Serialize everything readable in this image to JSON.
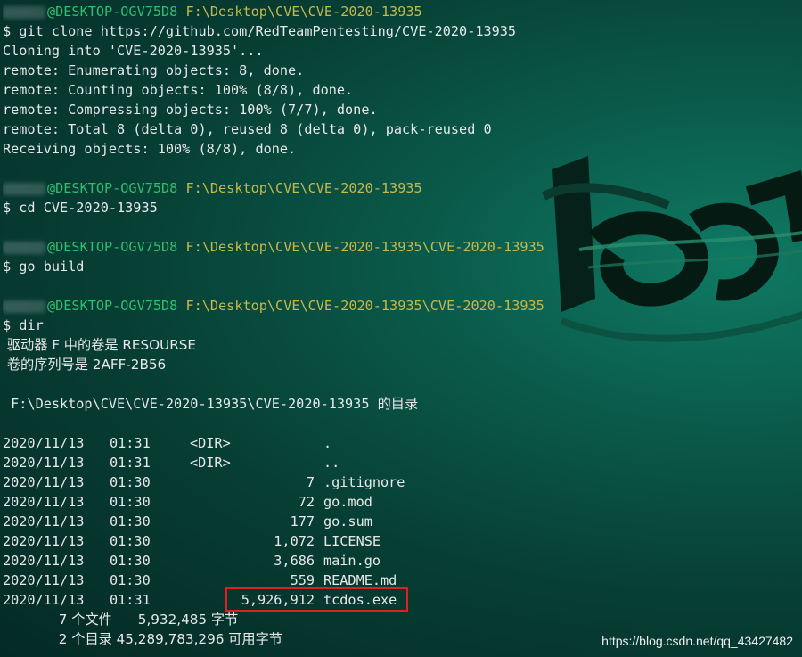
{
  "session1": {
    "host": "@DESKTOP-OGV75D8",
    "path": "F:\\Desktop\\CVE\\CVE-2020-13935",
    "command": "$ git clone https://github.com/RedTeamPentesting/CVE-2020-13935",
    "output": [
      "Cloning into 'CVE-2020-13935'...",
      "remote: Enumerating objects: 8, done.",
      "remote: Counting objects: 100% (8/8), done.",
      "remote: Compressing objects: 100% (7/7), done.",
      "remote: Total 8 (delta 0), reused 8 (delta 0), pack-reused 0",
      "Receiving objects: 100% (8/8), done."
    ]
  },
  "session2": {
    "host": "@DESKTOP-OGV75D8",
    "path": "F:\\Desktop\\CVE\\CVE-2020-13935",
    "command": "$ cd CVE-2020-13935"
  },
  "session3": {
    "host": "@DESKTOP-OGV75D8",
    "path": "F:\\Desktop\\CVE\\CVE-2020-13935\\CVE-2020-13935",
    "command": "$ go build"
  },
  "session4": {
    "host": "@DESKTOP-OGV75D8",
    "path": "F:\\Desktop\\CVE\\CVE-2020-13935\\CVE-2020-13935",
    "command": "$ dir",
    "volume": " 驱动器 F 中的卷是 RESOURSE",
    "serial": " 卷的序列号是 2AFF-2B56",
    "directory": " F:\\Desktop\\CVE\\CVE-2020-13935\\CVE-2020-13935 的目录"
  },
  "listing": [
    {
      "date": "2020/11/13",
      "time": "01:31",
      "type": "<DIR>",
      "size": "",
      "name": "."
    },
    {
      "date": "2020/11/13",
      "time": "01:31",
      "type": "<DIR>",
      "size": "",
      "name": ".."
    },
    {
      "date": "2020/11/13",
      "time": "01:30",
      "type": "",
      "size": "7",
      "name": ".gitignore"
    },
    {
      "date": "2020/11/13",
      "time": "01:30",
      "type": "",
      "size": "72",
      "name": "go.mod"
    },
    {
      "date": "2020/11/13",
      "time": "01:30",
      "type": "",
      "size": "177",
      "name": "go.sum"
    },
    {
      "date": "2020/11/13",
      "time": "01:30",
      "type": "",
      "size": "1,072",
      "name": "LICENSE"
    },
    {
      "date": "2020/11/13",
      "time": "01:30",
      "type": "",
      "size": "3,686",
      "name": "main.go"
    },
    {
      "date": "2020/11/13",
      "time": "01:30",
      "type": "",
      "size": "559",
      "name": "README.md"
    },
    {
      "date": "2020/11/13",
      "time": "01:31",
      "type": "",
      "size": "5,926,912",
      "name": "tcdos.exe"
    }
  ],
  "summary": {
    "files": "             7 个文件      5,932,485 字节",
    "dirs": "             2 个目录 45,289,783,296 可用字节"
  },
  "watermark": "https://blog.csdn.net/qq_43427482",
  "colors": {
    "host": "#2fbf71",
    "path": "#c6b84a",
    "highlight": "#e02020"
  }
}
